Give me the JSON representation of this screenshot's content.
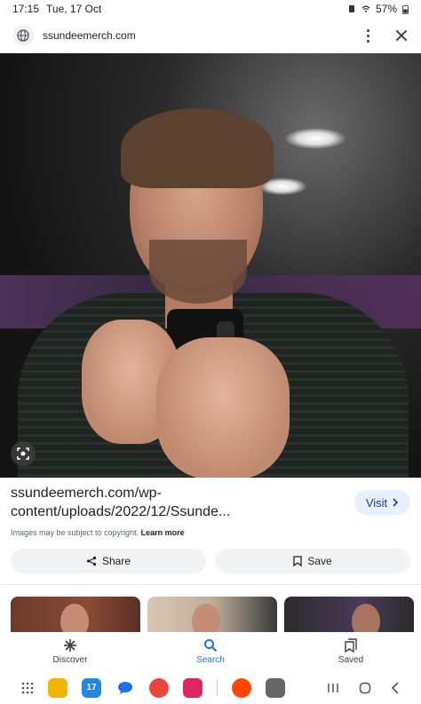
{
  "status_bar": {
    "time": "17:15",
    "date": "Tue, 17 Oct",
    "battery": "57%"
  },
  "browser": {
    "url": "ssundeemerch.com",
    "icons": [
      "globe-icon",
      "more-vert-icon",
      "close-icon"
    ]
  },
  "image_result": {
    "source_title": "ssundeemerch.com/wp-content/uploads/2022/12/Ssunde...",
    "visit_label": "Visit",
    "copyright_text": "Images may be subject to copyright.",
    "learn_more_label": "Learn more",
    "share_label": "Share",
    "save_label": "Save"
  },
  "bottom_nav": {
    "items": [
      {
        "label": "Discover",
        "icon": "asterisk-icon"
      },
      {
        "label": "Search",
        "icon": "search-icon"
      },
      {
        "label": "Saved",
        "icon": "bookmarks-icon"
      }
    ],
    "active": "Search"
  },
  "dock": {
    "calendar_day": "17",
    "apps": [
      "app-drawer",
      "files",
      "calendar",
      "messages",
      "contacts",
      "camera",
      "reddit",
      "roblox"
    ]
  },
  "colors": {
    "accent": "#1a73e8",
    "visit_bg": "#e8f0fe",
    "pill_bg": "#f1f3f4"
  }
}
